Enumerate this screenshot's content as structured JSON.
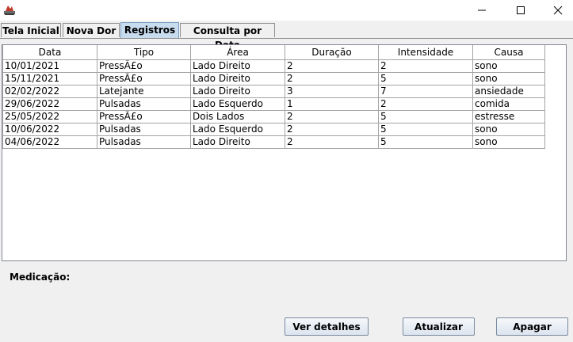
{
  "window": {
    "minimize_glyph": "—",
    "maximize_glyph": "☐",
    "close_glyph": "✕"
  },
  "tabs": [
    {
      "label": "Tela Inicial",
      "active": false
    },
    {
      "label": "Nova Dor",
      "active": false
    },
    {
      "label": "Registros",
      "active": true
    },
    {
      "label": "Consulta por Data",
      "active": false
    }
  ],
  "table": {
    "columns": [
      "Data",
      "Tipo",
      "Área",
      "Duração",
      "Intensidade",
      "Causa"
    ],
    "rows": [
      [
        "10/01/2021",
        "PressÃ£o",
        "Lado Direito",
        "2",
        "2",
        "sono"
      ],
      [
        "15/11/2021",
        "PressÃ£o",
        "Lado Direito",
        "2",
        "5",
        "sono"
      ],
      [
        "02/02/2022",
        "Latejante",
        "Lado Direito",
        "3",
        "7",
        "ansiedade"
      ],
      [
        "29/06/2022",
        "Pulsadas",
        "Lado Esquerdo",
        "1",
        "2",
        "comida"
      ],
      [
        "25/05/2022",
        "PressÃ£o",
        "Dois Lados",
        "2",
        "5",
        "estresse"
      ],
      [
        "10/06/2022",
        "Pulsadas",
        "Lado Esquerdo",
        "2",
        "5",
        "sono"
      ],
      [
        "04/06/2022",
        "Pulsadas",
        "Lado Direito",
        "2",
        "5",
        "sono"
      ]
    ]
  },
  "medicacao_label": "Medicação:",
  "buttons": {
    "details": "Ver detalhes",
    "refresh": "Atualizar",
    "delete": "Apagar"
  }
}
